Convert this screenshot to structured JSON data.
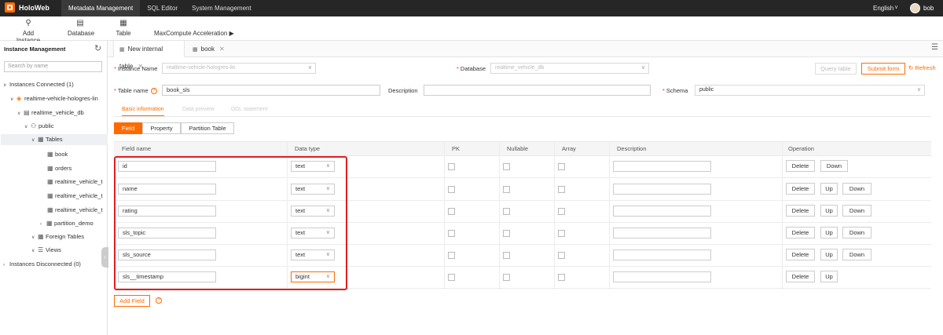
{
  "topbar": {
    "app_name": "HoloWeb",
    "nav": [
      "Metadata Management",
      "SQL Editor",
      "System Management"
    ],
    "language": "English",
    "user": "bob"
  },
  "toolbar": {
    "add_instance": "Add Instance",
    "database": "Database",
    "table": "Table",
    "maxcompute": "MaxCompute Acceleration ▶"
  },
  "sidebar": {
    "title": "Instance Management",
    "search_placeholder": "Search by name",
    "tree": {
      "connected": "Instances Connected (1)",
      "instance": "realtime-vehicle-hologres-lin",
      "db": "realtime_vehicle_db",
      "schema": "public",
      "tables": "Tables",
      "table_items": [
        "book",
        "orders",
        "realtime_vehicle_t",
        "realtime_vehicle_t",
        "realtime_vehicle_t"
      ],
      "partition": "partition_demo",
      "foreign": "Foreign Tables",
      "views": "Views",
      "disconnected": "Instances Disconnected (0)"
    }
  },
  "tabs": [
    "New internal table",
    "book"
  ],
  "form": {
    "instance_label": "Instance Name",
    "instance_value": "realtime-vehicle-hologres-lin",
    "database_label": "Database",
    "database_value": "realtime_vehicle_db",
    "query_table": "Query table",
    "submit_form": "Submit form",
    "refresh": "Refresh",
    "table_name_label": "Table name",
    "table_name_value": "book_sls",
    "description_label": "Description",
    "description_value": "",
    "schema_label": "Schema",
    "schema_value": "public"
  },
  "subtabs": [
    "Basic information",
    "Data preview",
    "DDL statement"
  ],
  "segments": [
    "Field",
    "Property",
    "Partition Table"
  ],
  "grid": {
    "headers": [
      "Field name",
      "Data type",
      "PK",
      "Nullable",
      "Array",
      "Description",
      "Operation"
    ],
    "rows": [
      {
        "name": "id",
        "type": "text",
        "ops": [
          "Delete",
          "Down"
        ]
      },
      {
        "name": "name",
        "type": "text",
        "ops": [
          "Delete",
          "Up",
          "Down"
        ]
      },
      {
        "name": "rating",
        "type": "text",
        "ops": [
          "Delete",
          "Up",
          "Down"
        ]
      },
      {
        "name": "sls_topic",
        "type": "text",
        "ops": [
          "Delete",
          "Up",
          "Down"
        ]
      },
      {
        "name": "sls_source",
        "type": "text",
        "ops": [
          "Delete",
          "Up",
          "Down"
        ]
      },
      {
        "name": "sls__timestamp",
        "type": "bigint",
        "ops": [
          "Delete",
          "Up"
        ]
      }
    ]
  },
  "add_field": "Add Field",
  "colors": {
    "accent": "#ff6a00",
    "highlight": "#e02020",
    "topbar": "#262626"
  },
  "icons": [
    "logo-icon",
    "caret-down-icon",
    "add-instance-icon",
    "database-icon",
    "table-icon",
    "refresh-icon",
    "table-tab-icon",
    "close-icon",
    "menu-icon",
    "help-icon",
    "checkbox-icon"
  ]
}
